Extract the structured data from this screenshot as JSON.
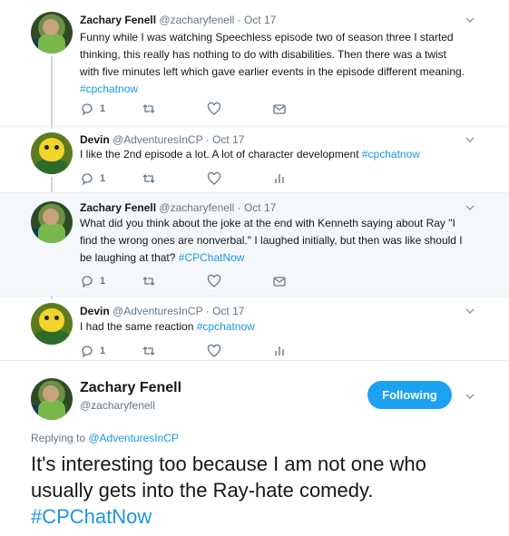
{
  "colors": {
    "link": "#1b95e0",
    "follow_button": "#1da1f2",
    "muted": "#657786",
    "shaded_row": "#f5f8fa"
  },
  "tweets": [
    {
      "avatar": "zachary-avatar",
      "name": "Zachary Fenell",
      "handle": "@zacharyfenell",
      "dot": "·",
      "date": "Oct 17",
      "text_lines": [
        "Funny while I was watching Speechless episode two of season three I started",
        "thinking, this really has nothing to do with disabilities. Then there was a twist",
        "with five minutes left which gave earlier events in the episode different meaning."
      ],
      "hashtag": "#cpchatnow",
      "reply_count": "1",
      "last_icon": "message-icon"
    },
    {
      "avatar": "devin-avatar",
      "name": "Devin",
      "handle": "@AdventuresInCP",
      "dot": "·",
      "date": "Oct 17",
      "text": "I like the 2nd episode a lot. A lot of character development ",
      "hashtag": "#cpchatnow",
      "reply_count": "1",
      "last_icon": "analytics-icon"
    },
    {
      "avatar": "zachary-avatar",
      "name": "Zachary Fenell",
      "handle": "@zacharyfenell",
      "dot": "·",
      "date": "Oct 17",
      "text_lines": [
        "What did you think about the joke at the end with Kenneth saying about Ray \"I",
        "find the wrong ones are nonverbal.\" I laughed initially, but then was like should I"
      ],
      "text_last": "be laughing at that? ",
      "hashtag": "#CPChatNow",
      "reply_count": "1",
      "last_icon": "message-icon"
    },
    {
      "avatar": "devin-avatar",
      "name": "Devin",
      "handle": "@AdventuresInCP",
      "dot": "·",
      "date": "Oct 17",
      "text": "I had the same reaction ",
      "hashtag": "#cpchatnow",
      "reply_count": "1",
      "last_icon": "analytics-icon"
    }
  ],
  "main_tweet": {
    "name": "Zachary Fenell",
    "handle": "@zacharyfenell",
    "follow_label": "Following",
    "replying_prefix": "Replying to ",
    "replying_to": "@AdventuresInCP",
    "text_line1": "It's interesting too because I am not one who",
    "text_line2": "usually gets into the Ray-hate comedy.",
    "hashtag": "#CPChatNow"
  }
}
